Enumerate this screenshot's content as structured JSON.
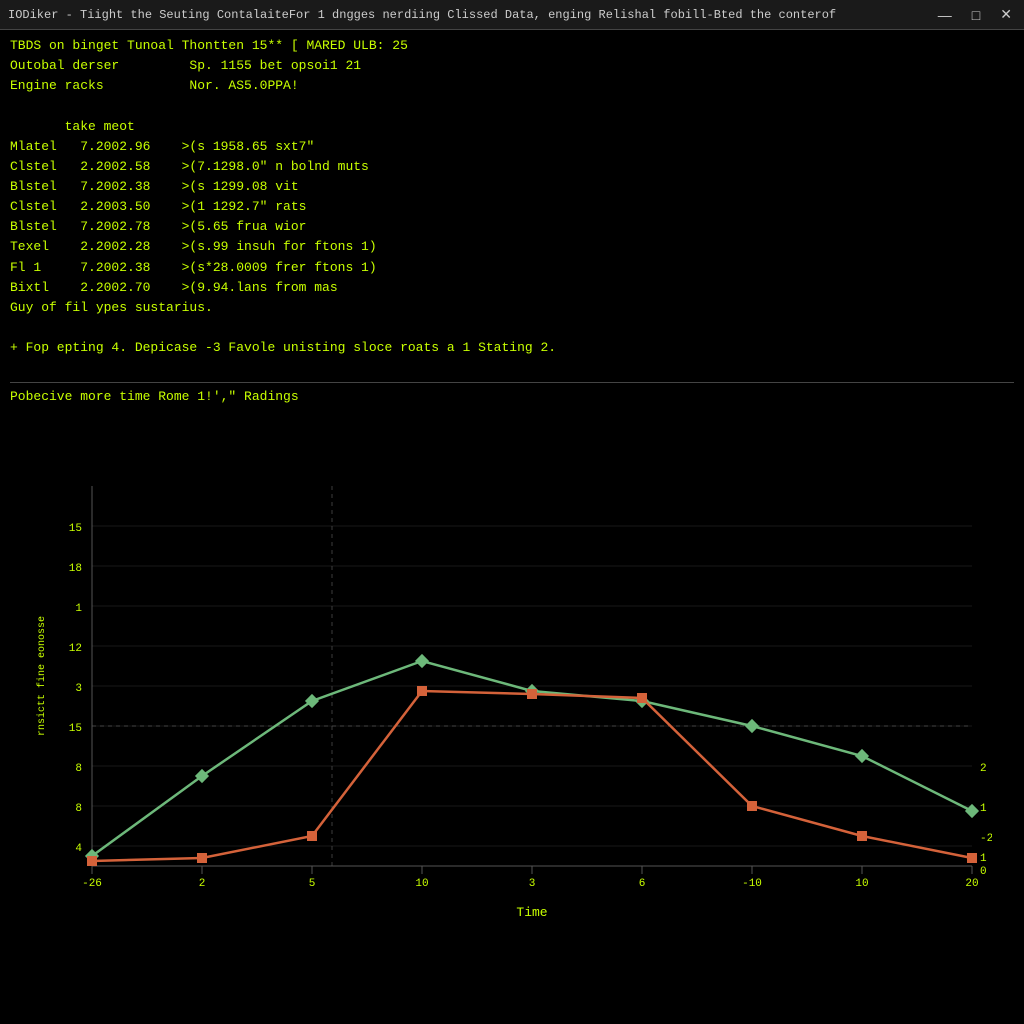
{
  "titlebar": {
    "title": "IODiker - Tiight the Seuting ContalaiteFor 1 dngges nerdiing Clissed Data, enging Relishal fobill-Bted the conterof",
    "minimize": "—",
    "maximize": "□",
    "close": "✕"
  },
  "terminal": {
    "line1": "TBDS on binget Tunoal Thontten 15** [ MARED ULB: 25",
    "line2": "Outobal derser         Sp. 1155 bet opsoi1 21",
    "line3": "Engine racks           Nor. AS5.0PPA!",
    "line4": "",
    "line5": "       take meot",
    "line6": "Mlatel   7.2002.96    >(s 1958.65 sxt7\"",
    "line7": "Clstel   2.2002.58    >(7.1298.0\" n bolnd muts",
    "line8": "Blstel   7.2002.38    >(s 1299.08 vit",
    "line9": "Clstel   2.2003.50    >(1 1292.7\" rats",
    "line10": "Blstel   7.2002.78    >(5.65 frua wior",
    "line11": "Texel    2.2002.28    >(s.99 insuh for ftons 1)",
    "line12": "Fl 1     7.2002.38    >(s*28.0009 frer ftons 1)",
    "line13": "Bixtl    2.2002.70    >(9.94.lans from mas",
    "line14": "Guy of fil ypes sustarius.",
    "line15": "",
    "line16": "+ Fop epting 4. Depicase -3 Favole unisting sloce roats a 1 Stating 2.",
    "line17": "",
    "line18": "Pobecive more time Rome 1!',\" Radings"
  },
  "chart": {
    "title": "",
    "x_label": "Time",
    "y_label": "rnsictt fine eonosse",
    "x_ticks": [
      "-26",
      "2",
      "5",
      "10",
      "3",
      "6",
      "-10",
      "10",
      "20"
    ],
    "y_ticks": [
      "15",
      "18",
      "1",
      "12",
      "3",
      "15",
      "8",
      "8",
      "4",
      "2",
      "1",
      "-2",
      "1",
      "0"
    ],
    "green_line_label": "green series",
    "orange_line_label": "orange series"
  }
}
